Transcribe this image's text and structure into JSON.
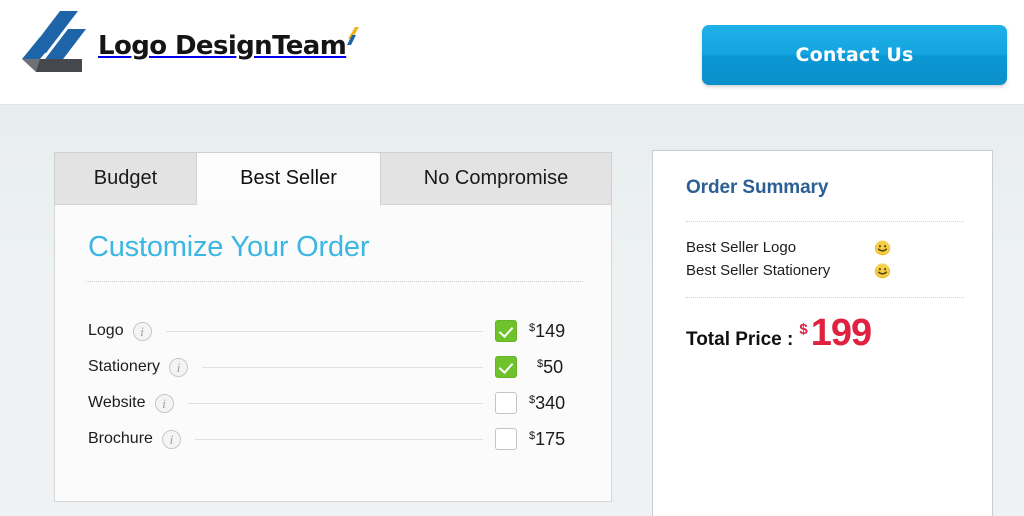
{
  "header": {
    "brand_name": "Logo DesignTeam",
    "brand_mark_name": "logo-designteam-mark",
    "accent_colors": {
      "blue": "#1d64a8",
      "gray": "#58595b",
      "yellow": "#f2b41d"
    },
    "contact_button_label": "Contact Us",
    "contact_button_color": "#12a2dd"
  },
  "tabs": [
    {
      "label": "Budget",
      "active": false
    },
    {
      "label": "Best Seller",
      "active": true
    },
    {
      "label": "No Compromise",
      "active": false
    }
  ],
  "order_panel": {
    "title": "Customize Your Order",
    "title_color": "#3cb6e3",
    "info_icon_glyph": "i",
    "items": [
      {
        "name": "Logo",
        "currency": "$",
        "price": "149",
        "checked": true
      },
      {
        "name": "Stationery",
        "currency": "$",
        "price": "50",
        "checked": true
      },
      {
        "name": "Website",
        "currency": "$",
        "price": "340",
        "checked": false
      },
      {
        "name": "Brochure",
        "currency": "$",
        "price": "175",
        "checked": false
      }
    ],
    "checked_color": "#6fc22b"
  },
  "summary": {
    "title": "Order Summary",
    "title_color": "#2c5f93",
    "items": [
      {
        "label": "Best Seller Logo",
        "icon": "smiley-face-icon"
      },
      {
        "label": "Best Seller Stationery",
        "icon": "smiley-face-icon"
      }
    ],
    "total_label": "Total Price :",
    "total_currency": "$",
    "total_amount": "199",
    "total_color": "#e0213f"
  }
}
